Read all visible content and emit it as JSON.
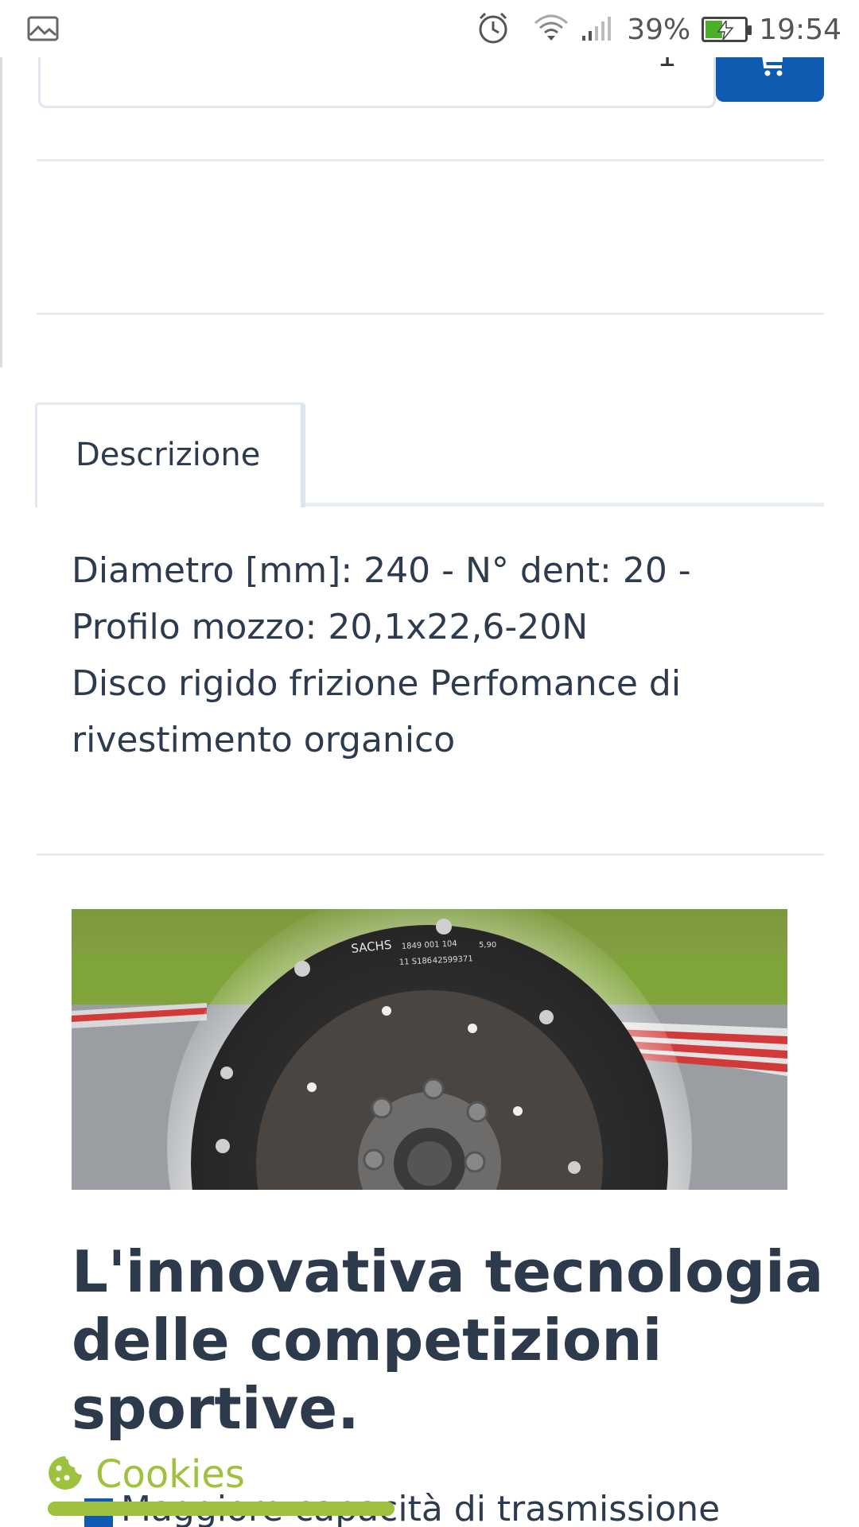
{
  "status_bar": {
    "battery": "39%",
    "time": "19:54",
    "icons": [
      "gallery-icon",
      "alarm-icon",
      "wifi-icon",
      "signal-icon",
      "battery-icon"
    ]
  },
  "cart": {
    "quantity": "1",
    "add_to_cart_icon": "cart-icon",
    "accent_color": "#0f5bb1"
  },
  "tabs": [
    {
      "label": "Descrizione",
      "active": true
    }
  ],
  "description": {
    "line1": "Diametro [mm]: 240 - N° dent: 20 -",
    "line2": "Profilo mozzo: 20,1x22,6-20N",
    "line3": "Disco rigido frizione Perfomance di",
    "line4": "rivestimento organico"
  },
  "product_image": {
    "print_brand": "SACHS",
    "print_code_1": "1849 001 104",
    "print_code_2": "11 S186",
    "print_code_3": "42599371",
    "print_small": "5,90"
  },
  "headline": {
    "line1": "L'innovativa tecnologia",
    "line2": "delle competizioni",
    "line3": "sportive."
  },
  "bullet": {
    "text": "Maggiore capacità di trasmissione"
  },
  "cookies": {
    "label": "Cookies",
    "icon": "cookie-icon",
    "color": "#9fc23e"
  }
}
